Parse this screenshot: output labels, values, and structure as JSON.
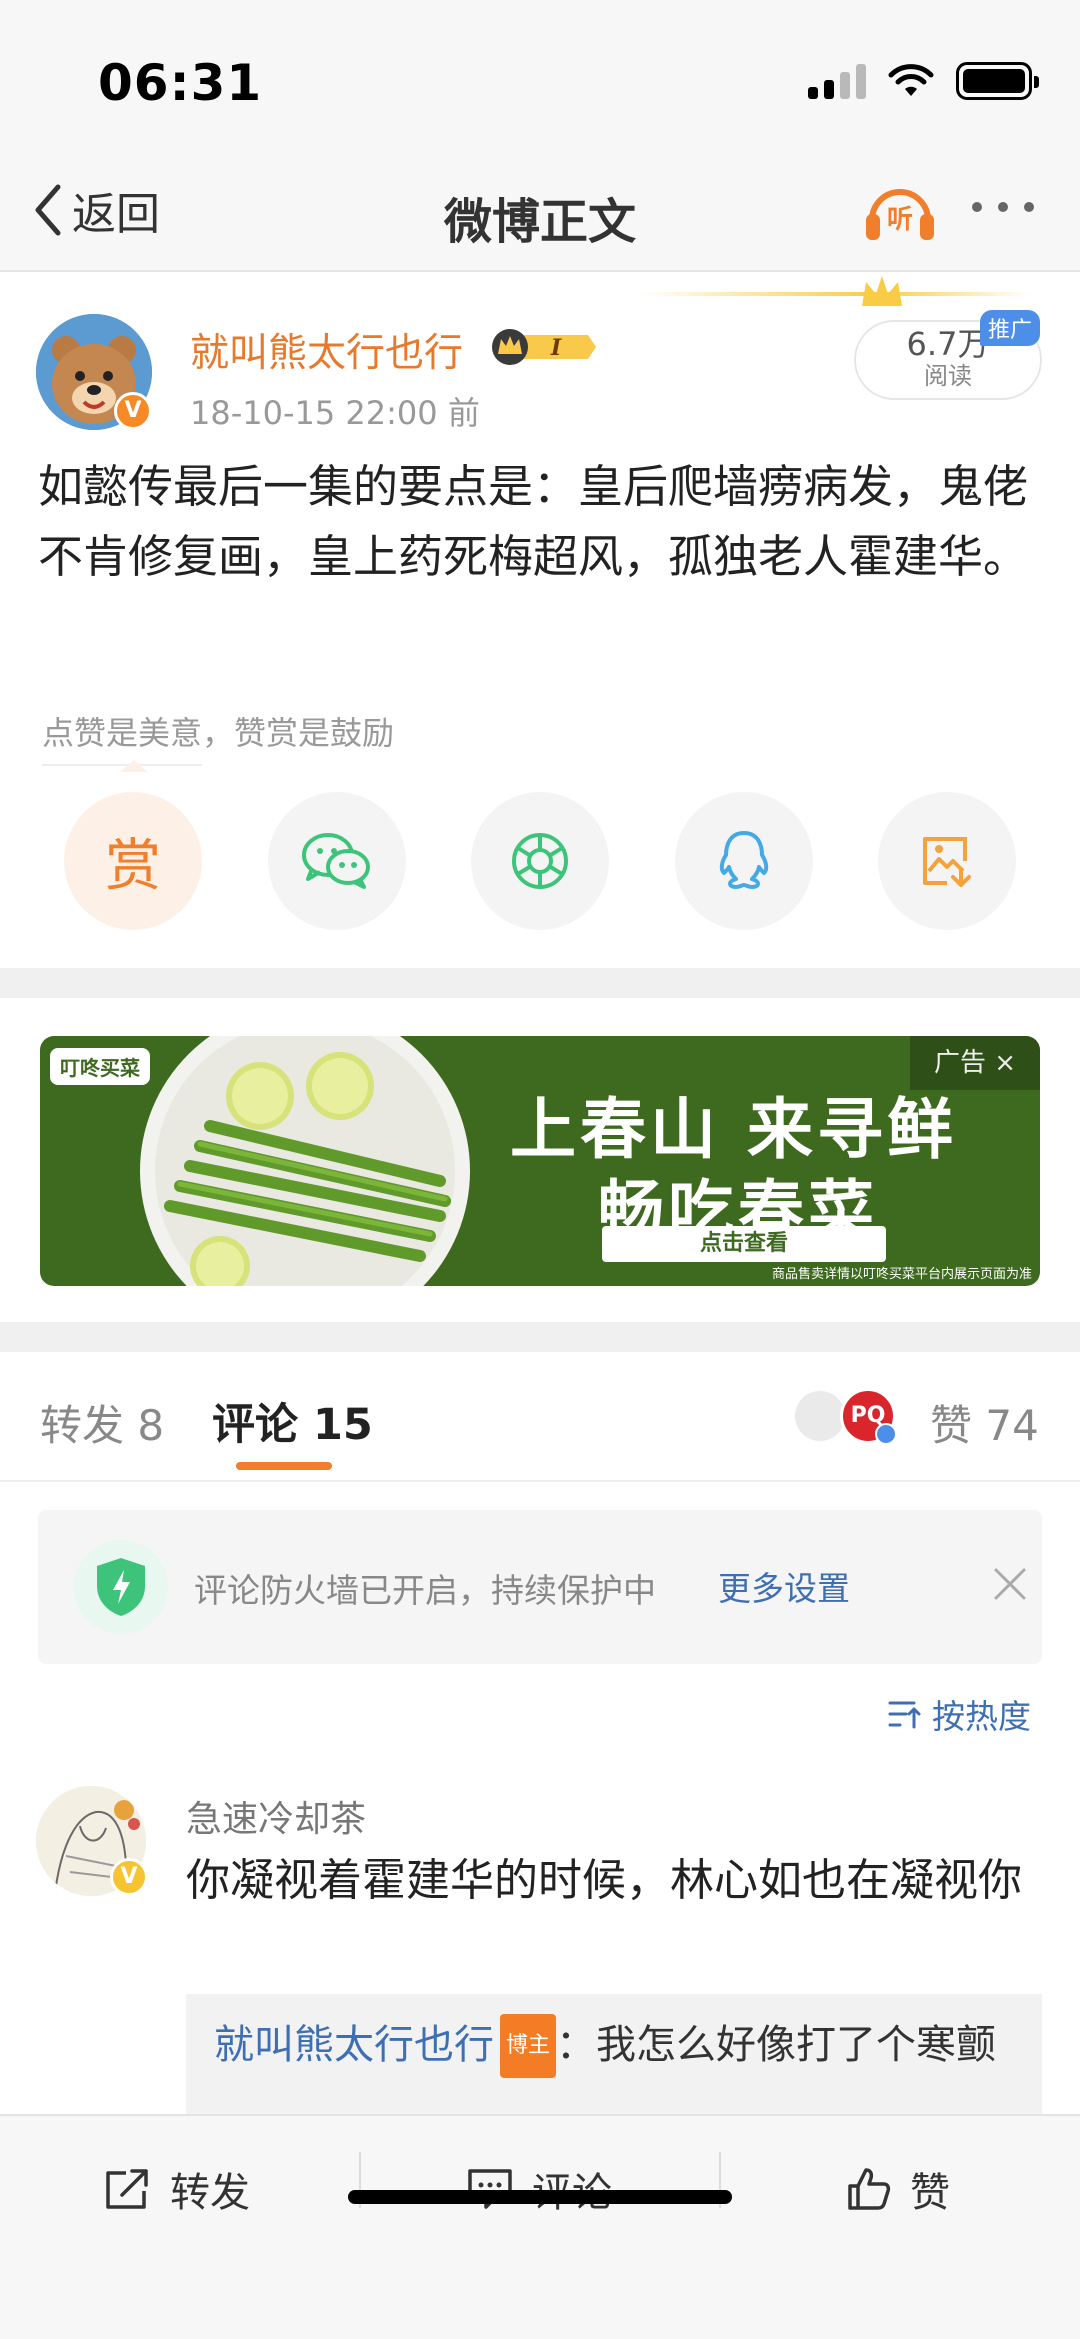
{
  "status_bar": {
    "time": "06:31"
  },
  "nav": {
    "back_label": "返回",
    "title": "微博正文",
    "listen_label": "听"
  },
  "post": {
    "author": "就叫熊太行也行",
    "level_badge": "I",
    "verified_mark": "V",
    "timestamp": "18-10-15 22:00  前",
    "reads_count": "6.7万",
    "reads_label": "阅读",
    "promo_label": "推广",
    "text": "如懿传最后一集的要点是：皇后爬墙痨病发，鬼佬不肯修复画，皇上药死梅超风，孤独老人霍建华。",
    "reward_hint": "点赞是美意，赞赏是鼓励",
    "reward_button": "赏",
    "share_icons": [
      "wechat-icon",
      "moments-icon",
      "qq-icon",
      "save-image-icon"
    ]
  },
  "ad": {
    "brand": "叮咚买菜",
    "title_line1": "上春山 来寻鲜",
    "title_line2": "畅吃春菜",
    "cta": "点击查看",
    "footnote": "商品售卖详情以叮咚买菜平台内展示页面为准",
    "ad_tag": "广告 ×",
    "theme_color": "#3e6a1f"
  },
  "tabs": {
    "repost_label": "转发 8",
    "comment_label": "评论 15",
    "liker2_initials": "PQ",
    "like_label": "赞 74",
    "accent_color": "#f07e2b"
  },
  "notice": {
    "text": "评论防火墙已开启，持续保护中",
    "link": "更多设置"
  },
  "sort": {
    "label": "按热度"
  },
  "comments": [
    {
      "name": "急速冷却茶",
      "verified_mark": "V",
      "text": "你凝视着霍建华的时候，林心如也在凝视你",
      "reply": {
        "name": "就叫熊太行也行",
        "tag": "博主",
        "text": "：我怎么好像打了个寒颤"
      }
    }
  ],
  "bottom_bar": {
    "repost": "转发",
    "comment": "评论",
    "like": "赞"
  }
}
